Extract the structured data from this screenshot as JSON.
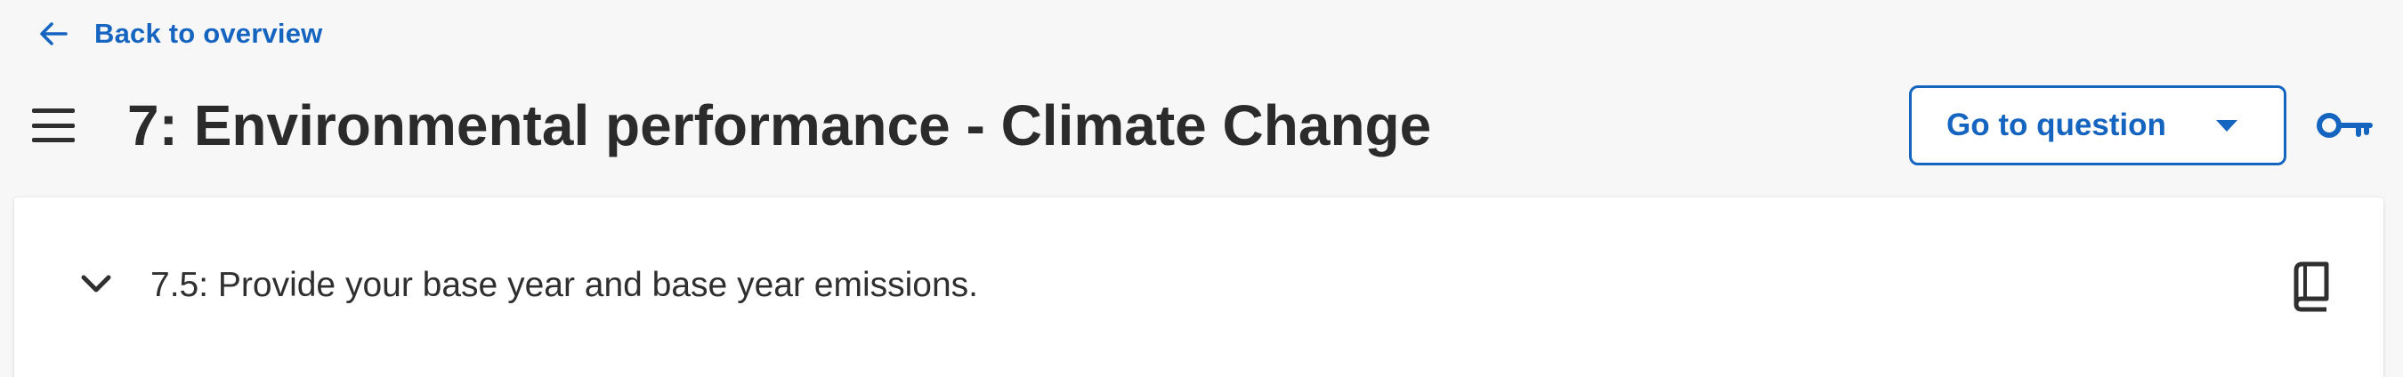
{
  "nav": {
    "back_label": "Back to overview"
  },
  "header": {
    "title": "7: Environmental performance - Climate Change",
    "goto_label": "Go to question",
    "menu_icon": "hamburger-menu-icon",
    "key_icon": "key-icon"
  },
  "question": {
    "text": "7.5: Provide your base year and base year emissions.",
    "expand_icon": "chevron-down-icon",
    "guidance_icon": "book-icon"
  },
  "colors": {
    "accent": "#1565c0",
    "text": "#2b2b2b",
    "background": "#f7f7f8",
    "card": "#ffffff"
  }
}
